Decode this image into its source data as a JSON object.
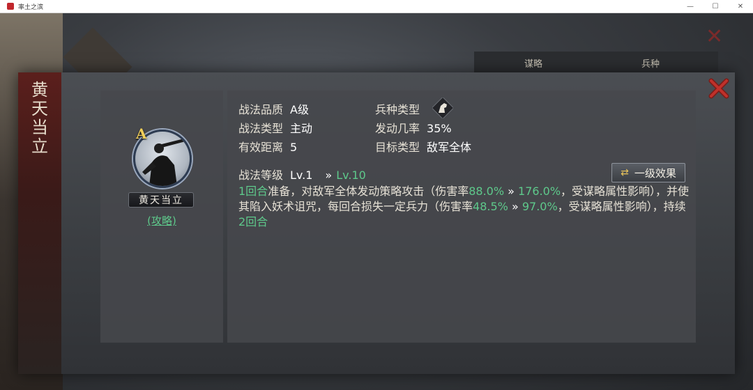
{
  "window": {
    "title": "率土之滨"
  },
  "background": {
    "tab_left": "谋略",
    "tab_right": "兵种"
  },
  "skill": {
    "title_chars": [
      "黄",
      "天",
      "当",
      "立"
    ],
    "name": "黄天当立",
    "grade_badge": "A",
    "guide_link": "(攻略)",
    "props": {
      "quality_label": "战法品质",
      "quality_value": "A级",
      "troop_label": "兵种类型",
      "troop_icon": "horse-icon",
      "type_label": "战法类型",
      "type_value": "主动",
      "rate_label": "发动几率",
      "rate_value": "35%",
      "range_label": "有效距离",
      "range_value": "5",
      "target_label": "目标类型",
      "target_value": "敌军全体"
    },
    "level": {
      "label": "战法等级",
      "current": "Lv.1",
      "arrow": "»",
      "max": "Lv.10"
    },
    "effect_button": {
      "icon": "⇄",
      "label": "一级效果"
    },
    "description": {
      "s1": "1回合",
      "s2": "准备，对敌军全体发动策略攻击（伤害率",
      "s3": "88.0%",
      "s4": "»",
      "s5": "176.0%",
      "s6": "，受谋略属性影响），并使其陷入妖术诅咒，每回合损失一定兵力（伤害率",
      "s7": "48.5%",
      "s8": "»",
      "s9": "97.0%",
      "s10": "，受谋略属性影响），持续",
      "s11": "2回合"
    }
  },
  "colors": {
    "accent_green": "#5ec98b",
    "gold": "#f1cf5a",
    "close_red": "#c0312b"
  }
}
